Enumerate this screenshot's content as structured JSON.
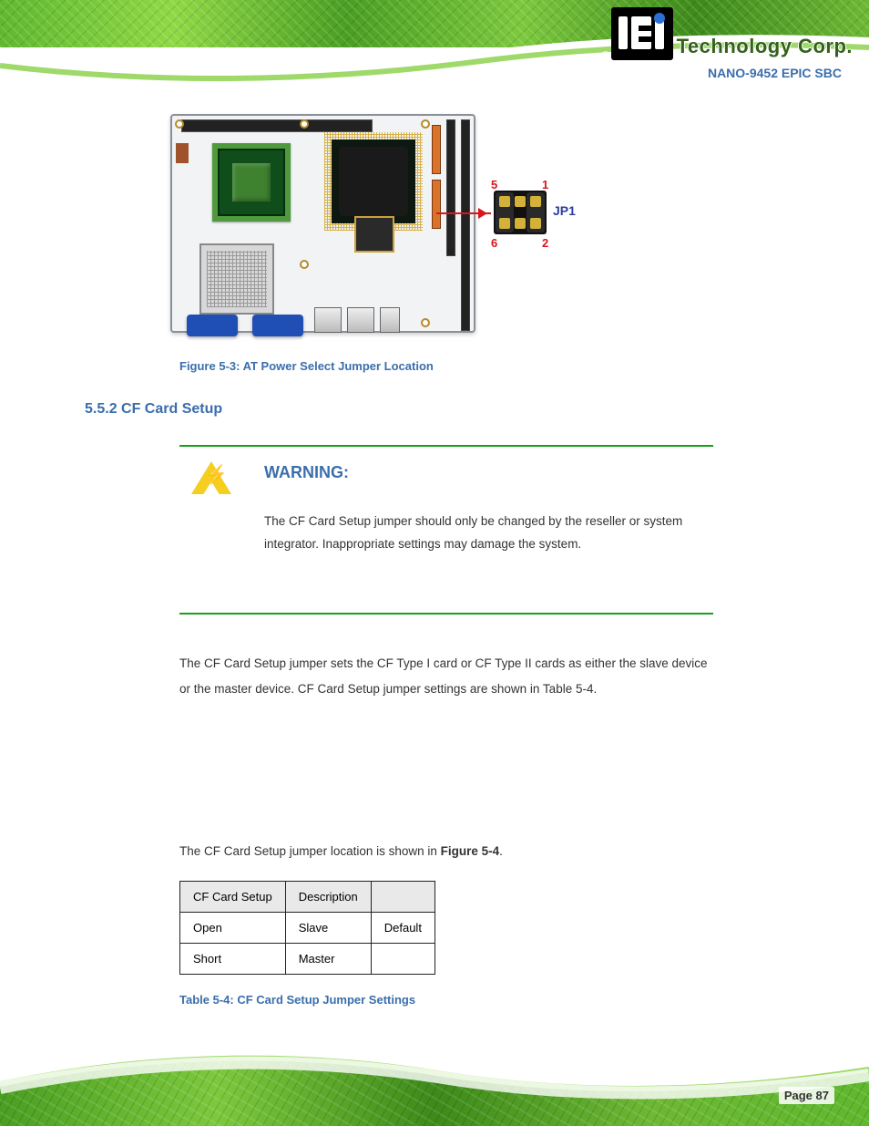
{
  "brand": {
    "company": "Technology Corp.",
    "reg": "®"
  },
  "product_name": "NANO-9452 EPIC SBC",
  "figure": {
    "jp_labels": {
      "tl": "5",
      "tr": "1",
      "bl": "6",
      "br": "2",
      "name": "JP1"
    },
    "caption": "Figure 5-3: AT Power Select Jumper Location"
  },
  "section": {
    "num_title": "5.5.2 CF Card Setup"
  },
  "warning": {
    "title": "WARNING:",
    "body": "The CF Card Setup jumper should only be changed by the reseller or system integrator. Inappropriate settings may damage the system."
  },
  "body": {
    "p1": "The CF Card Setup jumper sets the CF Type I card or CF Type II cards as either the slave device or the master device. CF Card Setup jumper settings are shown in Table 5-4.",
    "p2_before_ref": "The CF Card Setup jumper location is shown in ",
    "p2_ref": "Figure 5-4",
    "p2_after_ref": "."
  },
  "table": {
    "headers": [
      "CF Card Setup",
      "Description",
      ""
    ],
    "rows": [
      [
        "Open",
        "Slave",
        "Default"
      ],
      [
        "Short",
        "Master",
        ""
      ]
    ],
    "caption": "Table 5-4: CF Card Setup Jumper Settings"
  },
  "page": "Page 87"
}
